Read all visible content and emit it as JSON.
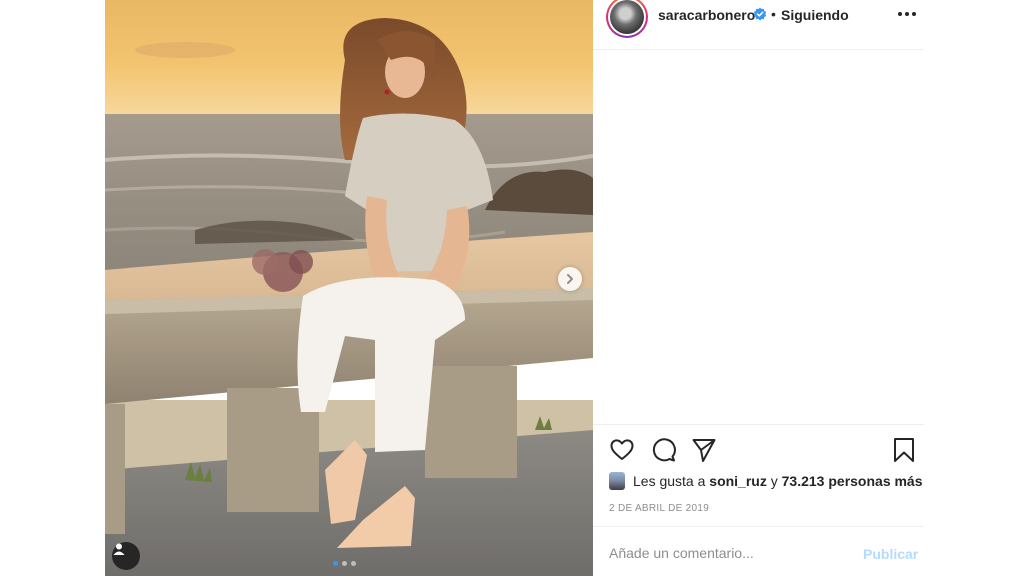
{
  "post": {
    "username": "saracarbonero",
    "bullet": "•",
    "follow_status": "Siguiendo",
    "verified_icon": "verified-badge-icon",
    "carousel": {
      "total_slides": 3,
      "active_index": 0
    }
  },
  "actions": {
    "icons": [
      "heart-icon",
      "comment-icon",
      "share-icon",
      "bookmark-icon"
    ]
  },
  "likes": {
    "prefix": "Les gusta a ",
    "user": "soni_ruz",
    "middle": " y ",
    "count": "73.213 personas más"
  },
  "date": "2 DE ABRIL DE 2019",
  "comment": {
    "placeholder": "Añade un comentario...",
    "publish_label": "Publicar"
  },
  "colors": {
    "accent": "#3897f0",
    "publish_disabled": "#b3dbff",
    "text": "#262626",
    "muted": "#8e8e8e",
    "divider": "#efefef"
  }
}
